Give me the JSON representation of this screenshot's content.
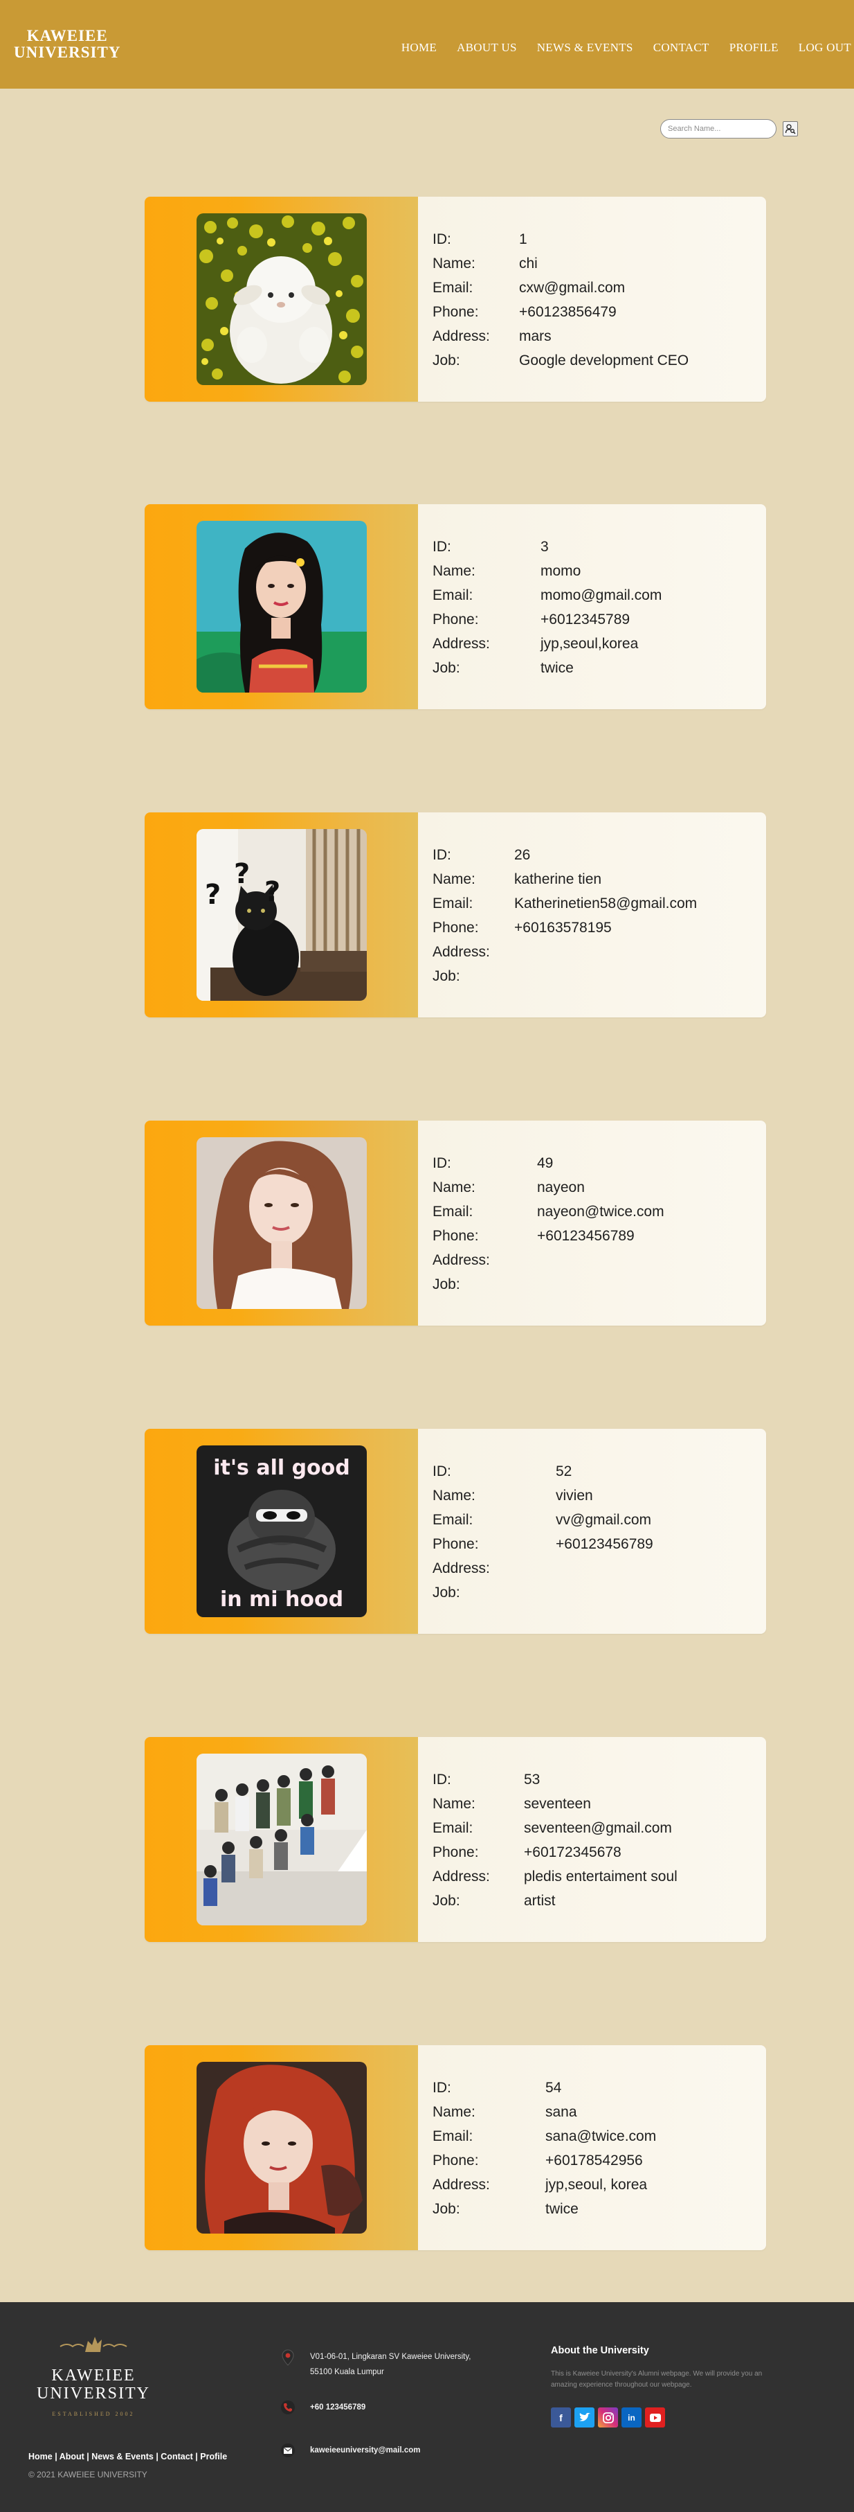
{
  "header": {
    "logo_line1": "KAWEIEE",
    "logo_line2": "UNIVERSITY",
    "nav": [
      "HOME",
      "ABOUT US",
      "NEWS & EVENTS",
      "CONTACT",
      "PROFILE",
      "LOG OUT"
    ]
  },
  "search": {
    "placeholder": "Search Name..."
  },
  "labels": {
    "id": "ID:",
    "name": "Name:",
    "email": "Email:",
    "phone": "Phone:",
    "address": "Address:",
    "job": "Job:"
  },
  "profiles": [
    {
      "id": "1",
      "name": "chi",
      "email": "cxw@gmail.com",
      "phone": "+60123856479",
      "address": "mars",
      "job": "Google development CEO",
      "photo": "white plush sheep in yellow flowers"
    },
    {
      "id": "3",
      "name": "momo",
      "email": "momo@gmail.com",
      "phone": "+6012345789",
      "address": "jyp,seoul,korea",
      "job": "twice",
      "photo": "portrait of a woman with dark hair"
    },
    {
      "id": "26",
      "name": "katherine tien",
      "email": "Katherinetien58@gmail.com",
      "phone": "+60163578195",
      "address": "",
      "job": "",
      "photo": "black cat with question marks"
    },
    {
      "id": "49",
      "name": "nayeon",
      "email": "nayeon@twice.com",
      "phone": "+60123456789",
      "address": "",
      "job": "",
      "photo": "portrait of a woman with brown hair"
    },
    {
      "id": "52",
      "name": "vivien",
      "email": "vv@gmail.com",
      "phone": "+60123456789",
      "address": "",
      "job": "",
      "photo": "hooded cartoon ninja drawing"
    },
    {
      "id": "53",
      "name": "seventeen",
      "email": "seventeen@gmail.com",
      "phone": "+60172345678",
      "address": "pledis entertaiment soul",
      "job": "artist",
      "photo": "group photo of a band"
    },
    {
      "id": "54",
      "name": "sana",
      "email": "sana@twice.com",
      "phone": "+60178542956",
      "address": "jyp,seoul, korea",
      "job": "twice",
      "photo": "portrait of a woman with red hair"
    }
  ],
  "photo_art": {
    "sheep": "it's all good",
    "ninja_top": "it's all good",
    "ninja_bottom": "in mi hood"
  },
  "footer": {
    "logo_title_1": "KAWEIEE",
    "logo_title_2": "UNIVERSITY",
    "established": "ESTABLISHED 2002",
    "address_1": "V01-06-01, Lingkaran SV Kaweiee University,",
    "address_2": "55100 Kuala Lumpur",
    "phone": "+60 123456789",
    "email": "kaweieeuniversity@mail.com",
    "links": "Home | About | News & Events | Contact | Profile",
    "copyright": "© 2021 KAWEIEE UNIVERSITY",
    "about_title": "About the University",
    "about_text": "This is Kaweiee University's Alumni webpage. We will provide you an amazing experience throughout our webpage.",
    "socials": [
      "facebook",
      "twitter",
      "instagram",
      "linkedin",
      "youtube"
    ]
  },
  "colors": {
    "header": "#c99a35",
    "page_bg": "#e6d9b8",
    "card_orange": "#fca70f",
    "card_info_bg": "#fbf8ef",
    "footer_bg": "#313131"
  }
}
